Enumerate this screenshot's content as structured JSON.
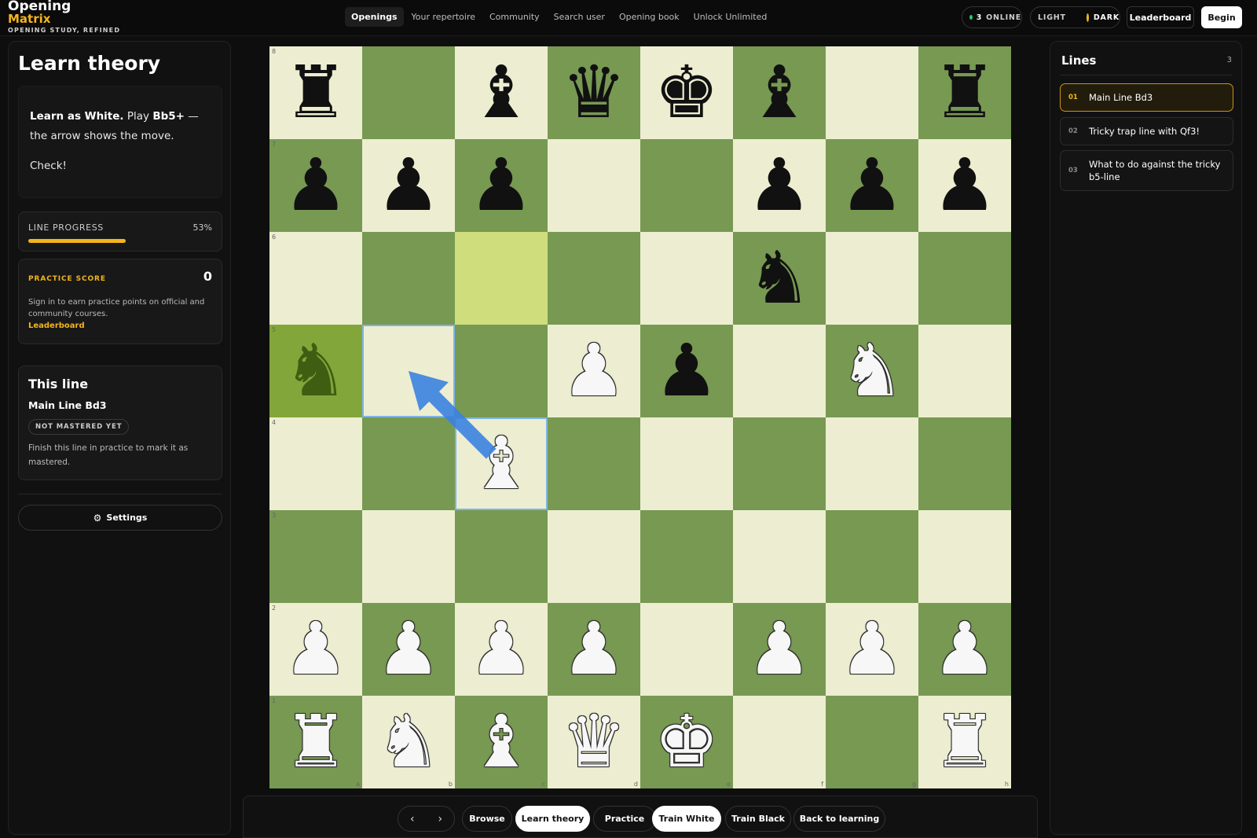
{
  "brand": {
    "line1": "Opening",
    "line2": "Matrix",
    "tagline": "OPENING STUDY, REFINED"
  },
  "nav": [
    {
      "label": "Openings",
      "active": true
    },
    {
      "label": "Your repertoire"
    },
    {
      "label": "Community"
    },
    {
      "label": "Search user"
    },
    {
      "label": "Opening book"
    },
    {
      "label": "Unlock Unlimited"
    }
  ],
  "status": {
    "online_count": "3",
    "online_label": "ONLINE",
    "light_label": "LIGHT",
    "dark_label": "DARK"
  },
  "header_buttons": {
    "leaderboard": "Leaderboard",
    "begin": "Begin"
  },
  "left": {
    "title": "Learn theory",
    "instruction": {
      "bold": "Learn as White.",
      "pre": " Play ",
      "move": "Bb5+",
      "post": " — the arrow shows the move.",
      "check": "Check!"
    },
    "progress": {
      "label": "LINE PROGRESS",
      "percent_text": "53%",
      "fraction": 0.53
    },
    "score": {
      "label": "PRACTICE SCORE",
      "value": "0",
      "text": "Sign in to earn practice points on official and community courses.",
      "link": "Leaderboard"
    },
    "this_line": {
      "title": "This line",
      "name": "Main Line Bd3",
      "badge": "NOT MASTERED YET",
      "text": "Finish this line in practice to mark it as mastered."
    },
    "settings": "Settings"
  },
  "board": {
    "ranks": [
      "8",
      "7",
      "6",
      "5",
      "4",
      "3",
      "2",
      "1"
    ],
    "files": [
      "a",
      "b",
      "c",
      "d",
      "e",
      "f",
      "g",
      "h"
    ],
    "position": [
      [
        "br",
        "",
        "bb",
        "bq",
        "bk",
        "bb",
        "",
        "br"
      ],
      [
        "bp",
        "bp",
        "bp",
        "",
        "",
        "bp",
        "bp",
        "bp"
      ],
      [
        "",
        "",
        "",
        "",
        "",
        "bn",
        "",
        ""
      ],
      [
        "bn",
        "",
        "",
        "wp",
        "bp",
        "",
        "wn",
        ""
      ],
      [
        "",
        "",
        "wb",
        "",
        "",
        "",
        "",
        ""
      ],
      [
        "",
        "",
        "",
        "",
        "",
        "",
        "",
        ""
      ],
      [
        "wp",
        "wp",
        "wp",
        "wp",
        "",
        "wp",
        "wp",
        "wp"
      ],
      [
        "wr",
        "wn",
        "wb",
        "wq",
        "wk",
        "",
        "",
        "wr"
      ]
    ],
    "last_move_squares": [
      "c6",
      "a5"
    ],
    "selected_squares": [
      "b5",
      "c4"
    ],
    "arrow": {
      "from": "c4",
      "to": "b5"
    },
    "colors": {
      "light": "#edeed1",
      "dark": "#779952",
      "arrow": "#3b82e0"
    }
  },
  "controls": {
    "prev": "‹",
    "next": "›",
    "buttons": [
      {
        "label": "Browse"
      },
      {
        "label": "Learn theory",
        "active": true
      },
      {
        "label": "Practice"
      },
      {
        "label": "Train White",
        "active": true
      },
      {
        "label": "Train Black"
      },
      {
        "label": "Back to learning"
      }
    ]
  },
  "lines": {
    "title": "Lines",
    "count": "3",
    "items": [
      {
        "no": "01",
        "name": "Main Line Bd3",
        "active": true
      },
      {
        "no": "02",
        "name": "Tricky trap line with Qf3!"
      },
      {
        "no": "03",
        "name": "What to do against the tricky b5-line"
      }
    ]
  },
  "accent_color": "#f3b51c"
}
